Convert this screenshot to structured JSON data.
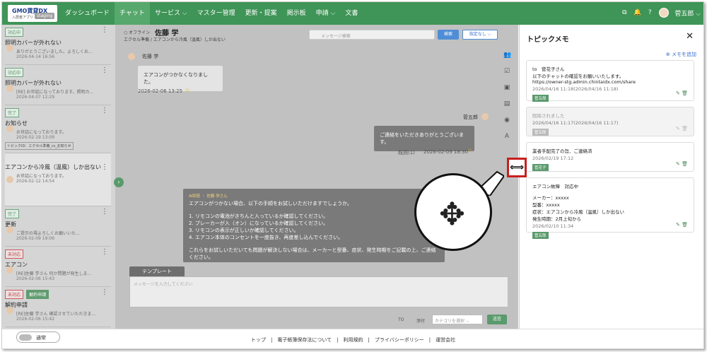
{
  "header": {
    "logo_line1": "GMO賃貸DX",
    "logo_line1_small": "入居者アプリ",
    "staging": "staging",
    "nav": [
      "ダッシュボード",
      "チャット",
      "サービス ⌵",
      "マスター管理",
      "更新・提案",
      "掲示板",
      "申請 ⌵",
      "文書"
    ],
    "user": "菅五郎 ⌵"
  },
  "left_list": [
    {
      "badge": "対応中",
      "title": "照明カバーが外れない",
      "preview": "ありがとうございました。よろしくお...",
      "date": "2026-04-14 16:56"
    },
    {
      "badge": "対応中",
      "title": "照明カバーが外れない",
      "preview": "[RE] お世話になっております。照明カ...",
      "date": "2026-04-07 12:29"
    },
    {
      "badge": "完了",
      "title": "お知らせ",
      "preview": "お世話になっております。",
      "date": "2026-02-19 13:09",
      "topic": "トピックID：エクセル準備_cs_お知らせ"
    },
    {
      "badge": "",
      "title": "エアコンから冷風（温風）しか出ない",
      "preview": "お世話になっております。",
      "date": "2026-02-12 14:54"
    },
    {
      "badge": "完了",
      "title": "更新",
      "preview": "ご提示の場よろしくお願いいた...",
      "date": "2026-02-09 19:06"
    },
    {
      "badge": "未対応",
      "title": "エアコン",
      "preview": "[RE]佐藤 学さん 何か問題が発生しま...",
      "date": "2026-02-06 15:43"
    },
    {
      "badge": "未対応",
      "badge2": "解約申請",
      "title": "解約申請",
      "preview": "[RE]佐藤 学さん 確認させていただきま...",
      "date": "2026-02-06 15:42"
    }
  ],
  "chat": {
    "status": "○ オフライン",
    "name": "佐藤 学",
    "sub": "エクセル準備 / エアコンから冷風（温風）しか出ない",
    "search_placeholder": "メッセージ検索",
    "search_btn": "検索",
    "filter": "指定なし ⌵",
    "sender1": "佐藤 学",
    "msg1": "エアコンがつかなくなりました。",
    "date1": "2026-02-06 13:25",
    "sender2": "菅五郎",
    "msg2": "ご連絡をいただきありがとうございます。",
    "read2": "既読(1)",
    "date2": "2026-02-09 18:30",
    "ai_tag": "AI回答 ・ 佐藤 学さん",
    "ai_lines": [
      "エアコンがつかない場合、以下の手順をお試しいただけますでしょうか。",
      "",
      "1. リモコンの電池がきちんと入っているか確認してください。",
      "2. ブレーカーが入（オン）になっているか確認してください。",
      "3. リモコンの表示が正しいか確認してください。",
      "4. エアコン本体のコンセントを一度抜き、再度差し込んでください。",
      "",
      "これらをお試しいただいても問題が解決しない場合は、メーカーと型番、症状、発生時期をご記載の上、ご連絡ください。"
    ],
    "template_tab": "テンプレート",
    "input_placeholder": "メッセージを入力してください",
    "to": "TO",
    "attach": "添付",
    "category": "カテゴリを選択 ⌵",
    "send": "送信"
  },
  "panel": {
    "title": "トピックメモ",
    "add": "メモを追加",
    "memos": [
      {
        "lines": [
          "to　菅花子さん",
          "以下のチャットの確認をお願いいたします。",
          "https://owner-stg.admin.chintaidx.com/share"
        ],
        "date": "2026/04/16 11:18(2026/04/16 11:18)",
        "tag": "菅五郎"
      },
      {
        "lines": [
          "削除されました"
        ],
        "date": "2026/04/16 11:17(2026/04/16 11:17)",
        "tag": "菅五郎",
        "deleted": true
      },
      {
        "lines": [
          "業者手配完了の旨、ご連絡済"
        ],
        "date": "2026/02/19 17:12",
        "tag": "菅花子"
      },
      {
        "lines": [
          "エアコン故障　対応中",
          "",
          "メーカー：xxxxx",
          "型番：xxxxx",
          "症状：エアコンから冷風（温風）しか出ない",
          "発生時期：2月上旬から"
        ],
        "date": "2026/02/10 11:34",
        "tag": "菅五郎"
      }
    ]
  },
  "footer": {
    "toggle": "通常",
    "links": "トップ　|　電子帳簿保存法について　|　利用規約　|　プライバシーポリシー　|　運営会社"
  },
  "icons": [
    "copy-icon",
    "bell-icon",
    "help-icon",
    "resize-horizontal-icon",
    "people-icon",
    "check-icon",
    "contact-icon",
    "document-icon",
    "faq-icon",
    "ai-icon",
    "pencil-icon",
    "trash-icon",
    "star-icon"
  ],
  "colors": {
    "brand": "#3f9457",
    "highlight": "#c91e1e"
  }
}
